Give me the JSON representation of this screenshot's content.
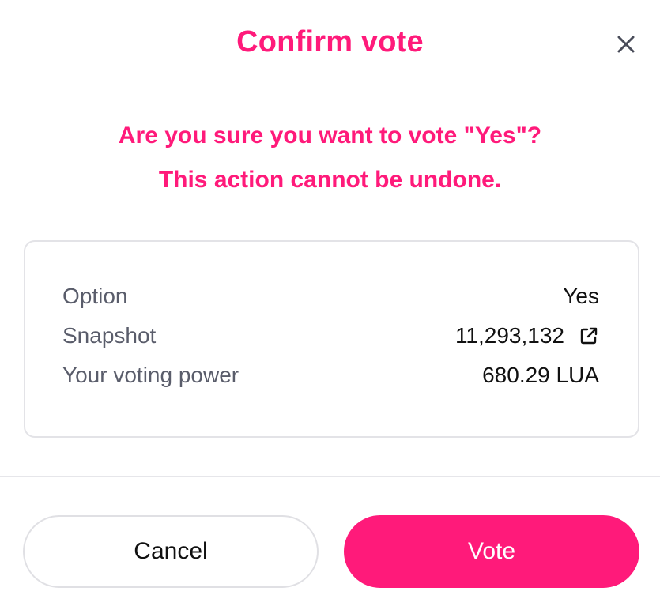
{
  "dialog": {
    "title": "Confirm vote",
    "close_icon": "close-icon",
    "warning_line1": "Are you sure you want to vote \"Yes\"?",
    "warning_line2": "This action cannot be undone.",
    "accent_color": "#ff1a7a"
  },
  "details": {
    "option_label": "Option",
    "option_value": "Yes",
    "snapshot_label": "Snapshot",
    "snapshot_value": "11,293,132",
    "snapshot_link_icon": "external-link-icon",
    "voting_power_label": "Your voting power",
    "voting_power_value": "680.29 LUA"
  },
  "actions": {
    "cancel_label": "Cancel",
    "vote_label": "Vote"
  }
}
